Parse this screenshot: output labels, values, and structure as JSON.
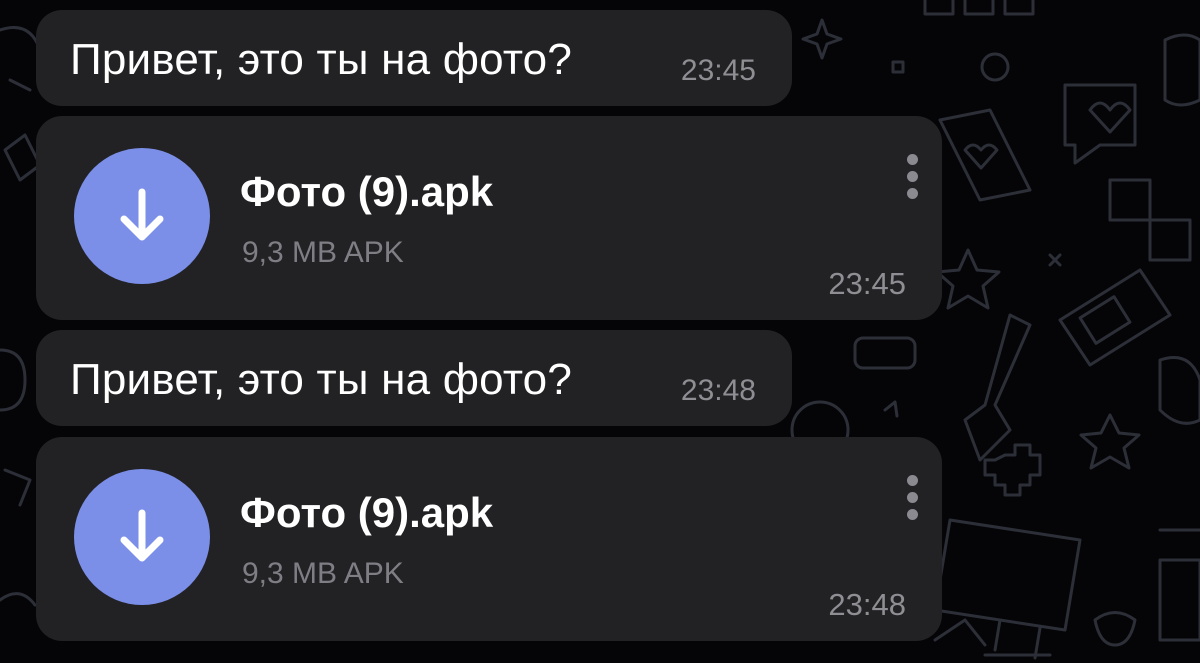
{
  "theme": {
    "background": "#050507",
    "bubble": "#222225",
    "accent": "#7b8fe8",
    "text_primary": "#ffffff",
    "text_secondary": "#8e8e93"
  },
  "messages": [
    {
      "type": "text",
      "text": "Привет, это ты на фото?",
      "time": "23:45"
    },
    {
      "type": "file",
      "file_name": "Фото (9).apk",
      "file_meta": "9,3 MB APK",
      "time": "23:45",
      "icon": "download-arrow-icon",
      "menu_icon": "more-vertical-icon"
    },
    {
      "type": "text",
      "text": "Привет, это ты на фото?",
      "time": "23:48"
    },
    {
      "type": "file",
      "file_name": "Фото (9).apk",
      "file_meta": "9,3 MB APK",
      "time": "23:48",
      "icon": "download-arrow-icon",
      "menu_icon": "more-vertical-icon"
    }
  ]
}
